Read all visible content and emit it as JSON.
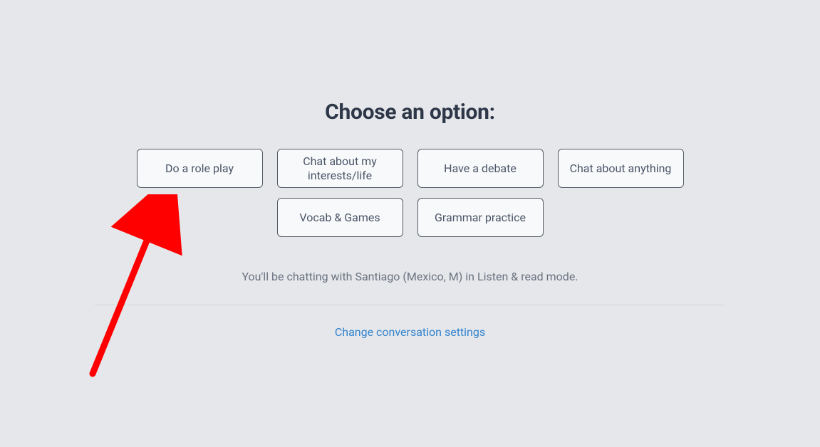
{
  "title": "Choose an option:",
  "options": {
    "row1": [
      {
        "id": "role-play",
        "label": "Do a role play"
      },
      {
        "id": "interests",
        "label": "Chat about my interests/life"
      },
      {
        "id": "debate",
        "label": "Have a debate"
      },
      {
        "id": "anything",
        "label": "Chat about anything"
      }
    ],
    "row2": [
      {
        "id": "vocab",
        "label": "Vocab & Games"
      },
      {
        "id": "grammar",
        "label": "Grammar practice"
      }
    ]
  },
  "info_text": "You'll be chatting with Santiago (Mexico, M) in Listen & read mode.",
  "settings_link": "Change conversation settings",
  "annotation": {
    "arrow_color": "#ff0000"
  }
}
